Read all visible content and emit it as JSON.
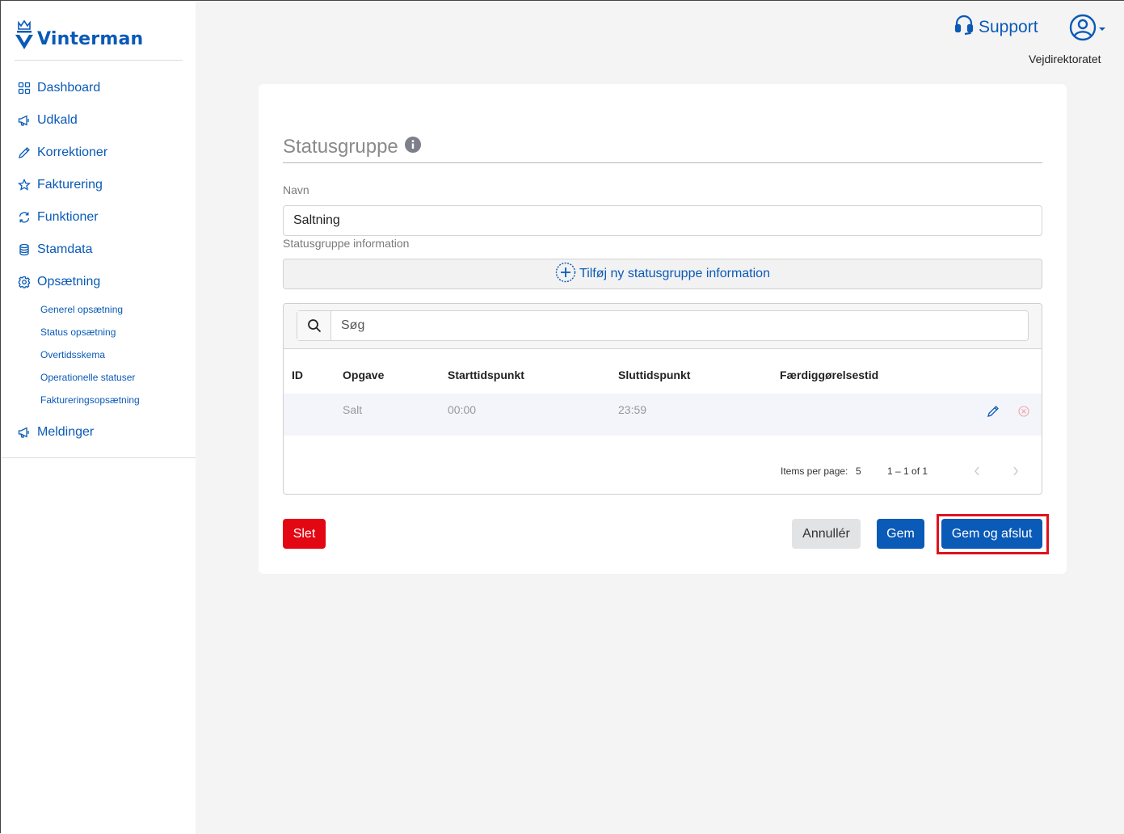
{
  "app": {
    "brand": "Vinterman",
    "brand_color": "#0a5ab7"
  },
  "sidebar": {
    "items": [
      {
        "label": "Dashboard",
        "icon": "grid-icon"
      },
      {
        "label": "Udkald",
        "icon": "megaphone-icon"
      },
      {
        "label": "Korrektioner",
        "icon": "pencil-icon"
      },
      {
        "label": "Fakturering",
        "icon": "star-icon"
      },
      {
        "label": "Funktioner",
        "icon": "refresh-icon"
      },
      {
        "label": "Stamdata",
        "icon": "database-icon"
      },
      {
        "label": "Opsætning",
        "icon": "gear-icon"
      }
    ],
    "subitems": [
      {
        "label": "Generel opsætning"
      },
      {
        "label": "Status opsætning"
      },
      {
        "label": "Overtidsskema"
      },
      {
        "label": "Operationelle statuser"
      },
      {
        "label": "Faktureringsopsætning"
      }
    ],
    "bottom_item": {
      "label": "Meldinger",
      "icon": "megaphone-icon"
    }
  },
  "header": {
    "support_label": "Support",
    "organization": "Vejdirektoratet"
  },
  "form": {
    "title": "Statusgruppe",
    "name_label": "Navn",
    "name_value": "Saltning",
    "info_label": "Statusgruppe information",
    "add_label": "Tilføj ny statusgruppe information",
    "search_placeholder": "Søg"
  },
  "table": {
    "columns": [
      "ID",
      "Opgave",
      "Starttidspunkt",
      "Sluttidspunkt",
      "Færdiggørelsestid"
    ],
    "rows": [
      {
        "id": "",
        "opgave": "Salt",
        "start": "00:00",
        "slut": "23:59",
        "faerdig": ""
      }
    ],
    "items_per_page_label": "Items per page:",
    "items_per_page": "5",
    "range": "1 – 1 of 1"
  },
  "actions": {
    "delete": "Slet",
    "cancel": "Annullér",
    "save": "Gem",
    "save_close": "Gem og afslut"
  },
  "colors": {
    "danger": "#e30613",
    "primary": "#0a5ab7",
    "highlight": "#e0121d"
  }
}
